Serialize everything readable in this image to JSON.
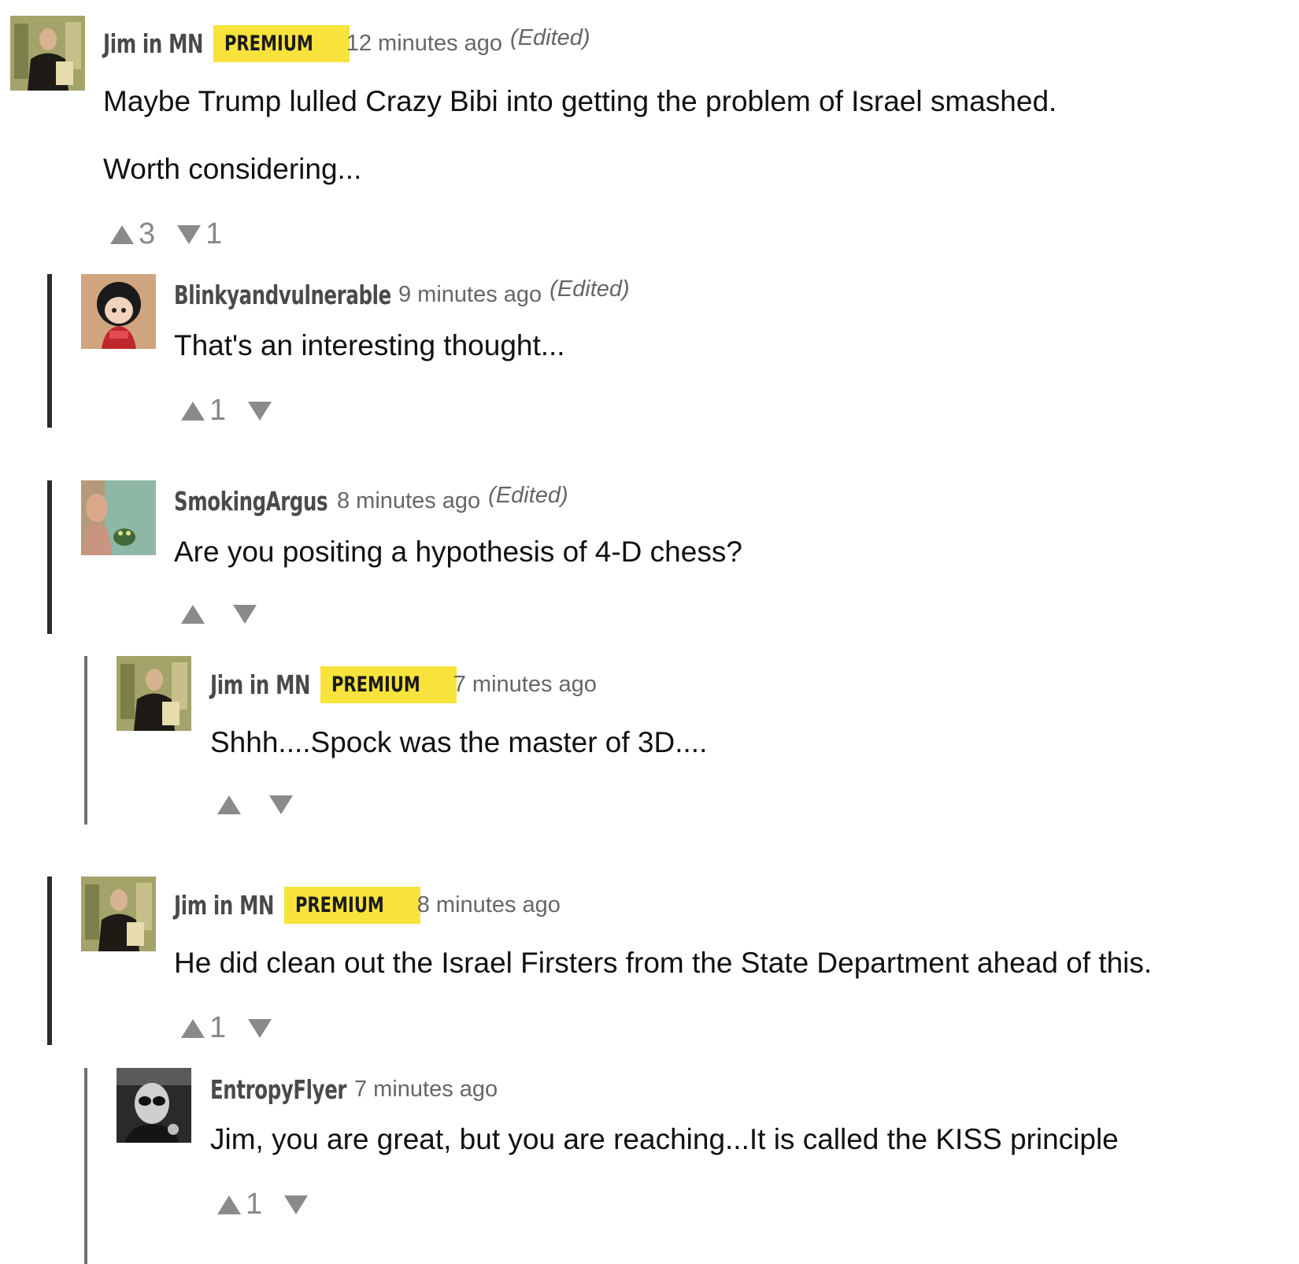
{
  "comments": [
    {
      "author": "Jim in MN",
      "badge": "PREMIUM",
      "time": "12 minutes ago",
      "edited": "(Edited)",
      "paragraphs": [
        "Maybe Trump lulled Crazy Bibi into getting the problem of Israel smashed.",
        "Worth considering..."
      ],
      "upvotes": "3",
      "downvotes": "1"
    },
    {
      "author": "Blinkyandvulnerable",
      "time": "9 minutes ago",
      "edited": "(Edited)",
      "paragraphs": [
        "That's an interesting thought..."
      ],
      "upvotes": "1",
      "downvotes": ""
    },
    {
      "author": "SmokingArgus",
      "time": "8 minutes ago",
      "edited": "(Edited)",
      "paragraphs": [
        "Are you positing a hypothesis of 4-D chess?"
      ],
      "upvotes": "",
      "downvotes": ""
    },
    {
      "author": "Jim in MN",
      "badge": "PREMIUM",
      "time": "7 minutes ago",
      "paragraphs": [
        "Shhh....Spock was the master of 3D...."
      ],
      "upvotes": "",
      "downvotes": ""
    },
    {
      "author": "Jim in MN",
      "badge": "PREMIUM",
      "time": "8 minutes ago",
      "paragraphs": [
        "He did clean out the Israel Firsters from the State Department ahead of this."
      ],
      "upvotes": "1",
      "downvotes": ""
    },
    {
      "author": "EntropyFlyer",
      "time": "7 minutes ago",
      "paragraphs": [
        "Jim, you are great, but you are reaching...It is called the KISS principle"
      ],
      "upvotes": "1",
      "downvotes": ""
    }
  ],
  "colors": {
    "badge": "#f7e33b",
    "thread_bar": "#2b2b2b",
    "nested_bar": "#6f6f6f",
    "vote_arrow": "#8a8a8a"
  },
  "icons": {
    "upvote": "triangle-up-icon",
    "downvote": "triangle-down-icon"
  }
}
